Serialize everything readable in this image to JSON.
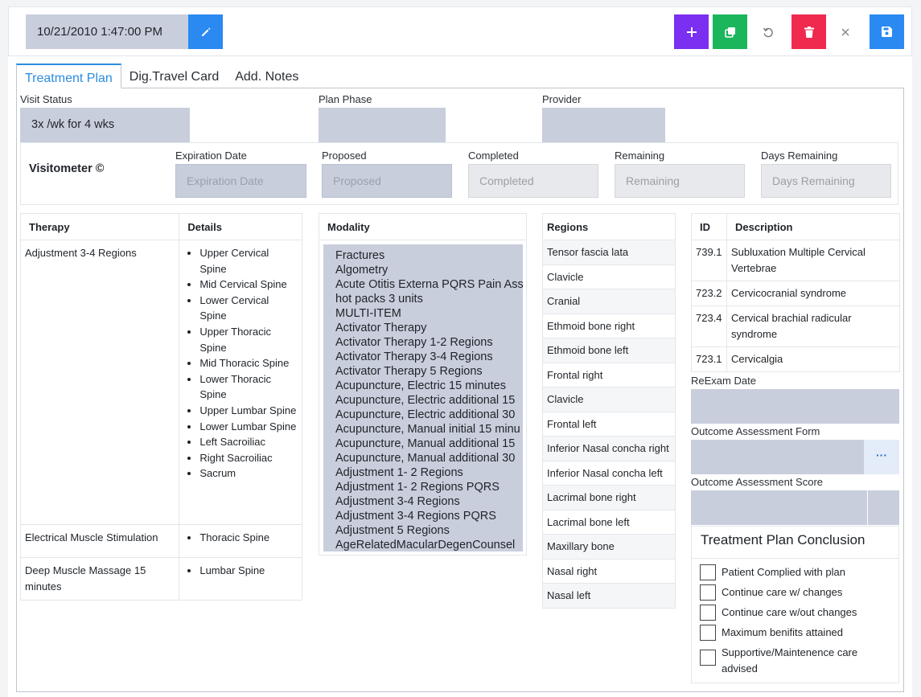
{
  "header": {
    "datetime": "10/21/2010 1:47:00 PM",
    "icons": {
      "edit": "pencil-icon",
      "add": "plus-icon",
      "copy": "copy-icon",
      "undo": "undo-icon",
      "delete": "trash-icon",
      "close": "close-icon",
      "save": "save-icon"
    },
    "colors": {
      "edit": "#2a8af2",
      "add": "#7b2ff0",
      "copy": "#1bb55c",
      "delete": "#f0294f",
      "save": "#2a8af2"
    }
  },
  "tabs": [
    "Treatment Plan",
    "Dig.Travel Card",
    "Add. Notes"
  ],
  "form": {
    "visit_status_label": "Visit Status",
    "visit_status_value": "3x /wk for 4 wks",
    "plan_phase_label": "Plan Phase",
    "provider_label": "Provider"
  },
  "visitometer": {
    "title": "Visitometer ©",
    "fields": [
      {
        "label": "Expiration Date",
        "placeholder": "Expiration Date"
      },
      {
        "label": "Proposed",
        "placeholder": "Proposed"
      },
      {
        "label": "Completed",
        "placeholder": "Completed"
      },
      {
        "label": "Remaining",
        "placeholder": "Remaining"
      },
      {
        "label": "Days Remaining",
        "placeholder": "Days Remaining"
      }
    ]
  },
  "therapy": {
    "headers": [
      "Therapy",
      "Details"
    ],
    "rows": [
      {
        "therapy": "Adjustment 3-4 Regions",
        "details": [
          "Upper Cervical Spine",
          "Mid Cervical Spine",
          "Lower Cervical Spine",
          "Upper Thoracic Spine",
          "Mid Thoracic Spine",
          "Lower Thoracic Spine",
          "Upper Lumbar Spine",
          "Lower Lumbar Spine",
          "Left Sacroiliac",
          "Right Sacroiliac",
          "Sacrum"
        ]
      },
      {
        "therapy": "Electrical Muscle Stimulation",
        "details": [
          "Thoracic Spine"
        ]
      },
      {
        "therapy": "Deep Muscle Massage 15 minutes",
        "details": [
          "Lumbar Spine"
        ]
      }
    ]
  },
  "modality": {
    "header": "Modality",
    "items": [
      "Fractures",
      "Algometry",
      "Acute Otitis Externa PQRS Pain Ass",
      "hot packs 3 units",
      "MULTI-ITEM",
      "Activator Therapy",
      "Activator Therapy 1-2 Regions",
      "Activator Therapy 3-4 Regions",
      "Activator Therapy 5 Regions",
      "Acupuncture, Electric 15 minutes",
      "Acupuncture, Electric additional 15",
      "Acupuncture, Electric additional 30",
      "Acupuncture, Manual initial 15 minu",
      "Acupuncture, Manual additional 15",
      "Acupuncture, Manual additional 30",
      "Adjustment 1- 2 Regions",
      "Adjustment 1- 2 Regions PQRS",
      "Adjustment 3-4 Regions",
      "Adjustment 3-4 Regions PQRS",
      "Adjustment 5 Regions",
      "AgeRelatedMacularDegenCounsel"
    ]
  },
  "regions": {
    "header": "Regions",
    "items": [
      "Tensor fascia lata",
      "Clavicle",
      "Cranial",
      "Ethmoid bone right",
      "Ethmoid bone left",
      "Frontal right",
      "Clavicle",
      "Frontal left",
      "Inferior Nasal concha right",
      "Inferior Nasal concha left",
      "Lacrimal bone right",
      "Lacrimal bone left",
      "Maxillary bone",
      "Nasal right",
      "Nasal left"
    ]
  },
  "diagnosis": {
    "headers": [
      "ID",
      "Description"
    ],
    "rows": [
      {
        "id": "739.1",
        "description": "Subluxation Multiple Cervical Vertebrae"
      },
      {
        "id": "723.2",
        "description": "Cervicocranial syndrome"
      },
      {
        "id": "723.4",
        "description": "Cervical brachial radicular syndrome"
      },
      {
        "id": "723.1",
        "description": "Cervicalgia"
      }
    ]
  },
  "reexam_label": "ReExam Date",
  "outcome_form_label": "Outcome Assessment Form",
  "outcome_form_button": "···",
  "outcome_score_label": "Outcome Assessment Score",
  "conclusion": {
    "title": "Treatment Plan Conclusion",
    "options": [
      "Patient Complied with plan",
      "Continue care w/ changes",
      "Continue care w/out changes",
      "Maximum benifits attained",
      "Supportive/Maintenence care advised"
    ]
  }
}
